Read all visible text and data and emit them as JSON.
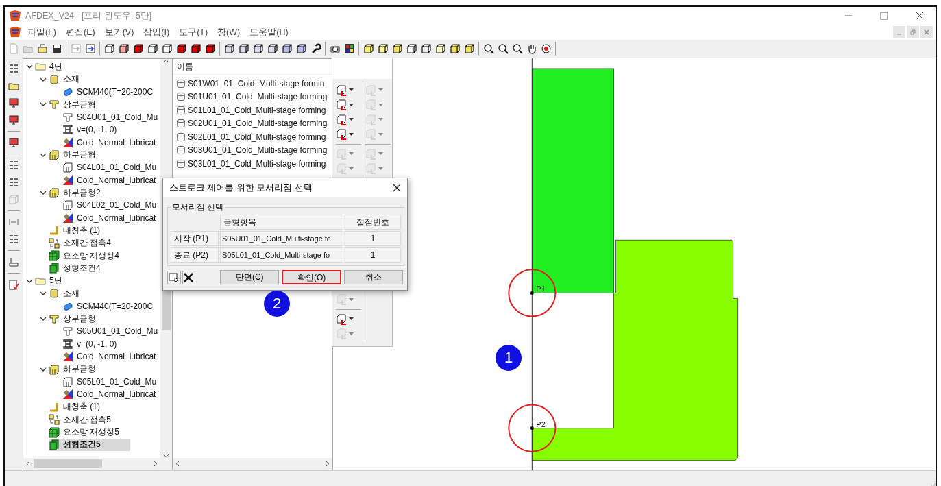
{
  "window": {
    "title": "AFDEX_V24 - [프리 윈도우: 5단]"
  },
  "menu": [
    "파일(F)",
    "편집(E)",
    "보기(V)",
    "삽입(I)",
    "도구(T)",
    "창(W)",
    "도움말(H)"
  ],
  "tree": [
    {
      "label": "4단",
      "kind": "folder",
      "expanded": true,
      "selected": false,
      "children": [
        {
          "label": "소재",
          "kind": "material",
          "expanded": true,
          "selected": false,
          "children": [
            {
              "label": "SCM440(T=20-200C",
              "kind": "steel",
              "selected": false
            }
          ]
        },
        {
          "label": "상부금형",
          "kind": "upper",
          "expanded": true,
          "selected": false,
          "children": [
            {
              "label": "S04U01_01_Cold_Mu",
              "kind": "upperpart",
              "selected": false
            },
            {
              "label": "v=(0, -1, 0)",
              "kind": "velocity",
              "selected": false
            },
            {
              "label": "Cold_Normal_lubricat",
              "kind": "lubricant",
              "selected": false
            }
          ]
        },
        {
          "label": "하부금형",
          "kind": "lower",
          "expanded": true,
          "selected": false,
          "children": [
            {
              "label": "S04L01_01_Cold_Mu",
              "kind": "lowerpart",
              "selected": false
            },
            {
              "label": "Cold_Normal_lubricat",
              "kind": "lubricant",
              "selected": false
            }
          ]
        },
        {
          "label": "하부금형2",
          "kind": "lower",
          "expanded": true,
          "selected": false,
          "children": [
            {
              "label": "S04L02_01_Cold_Mu",
              "kind": "lowerpart",
              "selected": false
            },
            {
              "label": "Cold_Normal_lubricat",
              "kind": "lubricant",
              "selected": false
            }
          ]
        },
        {
          "label": "대칭축 (1)",
          "kind": "axis",
          "selected": false
        },
        {
          "label": "소재간 접촉4",
          "kind": "contact",
          "selected": false
        },
        {
          "label": "요소망 재생성4",
          "kind": "mesh",
          "selected": false
        },
        {
          "label": "성형조건4",
          "kind": "condition",
          "selected": false
        }
      ]
    },
    {
      "label": "5단",
      "kind": "folder",
      "expanded": true,
      "selected": false,
      "children": [
        {
          "label": "소재",
          "kind": "material",
          "expanded": true,
          "selected": false,
          "children": [
            {
              "label": "SCM440(T=20-200C",
              "kind": "steel",
              "selected": false
            }
          ]
        },
        {
          "label": "상부금형",
          "kind": "upper",
          "expanded": true,
          "selected": false,
          "children": [
            {
              "label": "S05U01_01_Cold_Mu",
              "kind": "upperpart",
              "selected": false
            },
            {
              "label": "v=(0, -1, 0)",
              "kind": "velocity",
              "selected": false
            },
            {
              "label": "Cold_Normal_lubricat",
              "kind": "lubricant",
              "selected": false
            }
          ]
        },
        {
          "label": "하부금형",
          "kind": "lower",
          "expanded": true,
          "selected": false,
          "children": [
            {
              "label": "S05L01_01_Cold_Mu",
              "kind": "lowerpart",
              "selected": false
            },
            {
              "label": "Cold_Normal_lubricat",
              "kind": "lubricant",
              "selected": false
            }
          ]
        },
        {
          "label": "대칭축 (1)",
          "kind": "axis",
          "selected": false
        },
        {
          "label": "소재간 접촉5",
          "kind": "contact",
          "selected": false
        },
        {
          "label": "요소망 재생성5",
          "kind": "mesh",
          "selected": false
        },
        {
          "label": "성형조건5",
          "kind": "condition",
          "selected": true
        }
      ]
    }
  ],
  "list": {
    "header": "이름",
    "items": [
      "S01W01_01_Cold_Multi-stage formin",
      "S01U01_01_Cold_Multi-stage forming",
      "S01L01_01_Cold_Multi-stage forming",
      "S02U01_01_Cold_Multi-stage forming",
      "S02L01_01_Cold_Multi-stage forming",
      "S03U01_01_Cold_Multi-stage forming",
      "S03L01_01_Cold_Multi-stage forming"
    ]
  },
  "palette": {
    "columns": [
      {
        "groups": [
          {
            "tools": [
              {
                "disabled": false
              },
              {
                "disabled": false
              },
              {
                "disabled": false
              },
              {
                "disabled": false
              }
            ]
          },
          {
            "tools": [
              {
                "disabled": true
              },
              {
                "disabled": true
              }
            ]
          },
          {
            "tools": [
              {
                "disabled": true
              }
            ]
          },
          {
            "tools": [
              {
                "disabled": false
              },
              {
                "disabled": true
              }
            ]
          }
        ]
      },
      {
        "groups": [
          {
            "tools": [
              {
                "disabled": true
              },
              {
                "disabled": true
              },
              {
                "disabled": true
              },
              {
                "disabled": true
              }
            ]
          },
          {
            "tools": [
              {
                "disabled": true
              },
              {
                "disabled": true
              }
            ]
          }
        ]
      }
    ]
  },
  "canvas": {
    "points": [
      {
        "label": "P1"
      },
      {
        "label": "P2"
      }
    ]
  },
  "dialog": {
    "title": "스트로크 제어를 위한 모서리점 선택",
    "group": "모서리점 선택",
    "columns": [
      "금형항목",
      "절점번호"
    ],
    "rows": [
      {
        "label": "시작 (P1)",
        "die": "S05U01_01_Cold_Multi-stage fc",
        "node": "1"
      },
      {
        "label": "종료 (P2)",
        "die": "S05L01_01_Cold_Multi-stage fo",
        "node": "1"
      }
    ],
    "buttons": [
      {
        "label": "단면(C)",
        "highlighted": false
      },
      {
        "label": "확인(O)",
        "highlighted": true
      },
      {
        "label": "취소",
        "highlighted": false
      }
    ]
  },
  "markers": [
    {
      "label": "1"
    },
    {
      "label": "2"
    }
  ]
}
